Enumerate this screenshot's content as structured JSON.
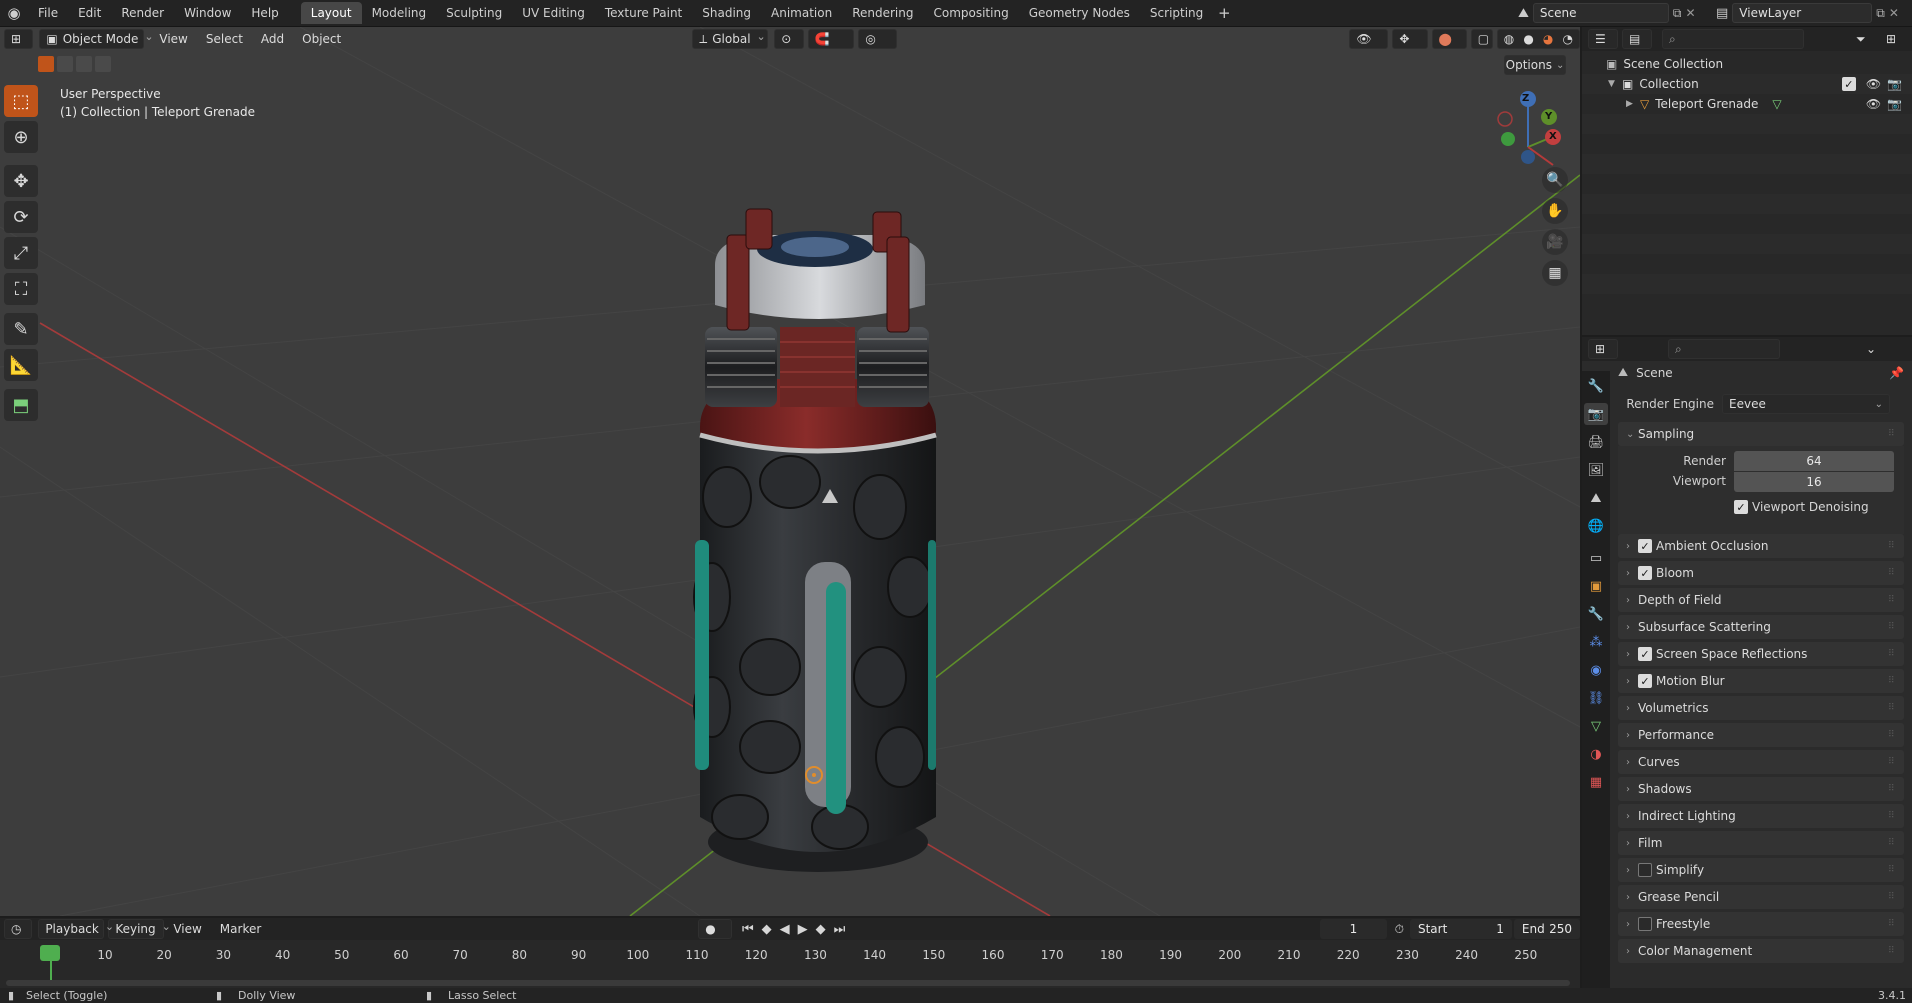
{
  "menu": [
    "File",
    "Edit",
    "Render",
    "Window",
    "Help"
  ],
  "workspaces": [
    "Layout",
    "Modeling",
    "Sculpting",
    "UV Editing",
    "Texture Paint",
    "Shading",
    "Animation",
    "Rendering",
    "Compositing",
    "Geometry Nodes",
    "Scripting"
  ],
  "active_workspace": "Layout",
  "scene_name": "Scene",
  "view_layer": "ViewLayer",
  "viewport": {
    "mode": "Object Mode",
    "menus": [
      "View",
      "Select",
      "Add",
      "Object"
    ],
    "orientation": "Global",
    "options_label": "Options",
    "perspective_label": "User Perspective",
    "collection_label": "(1) Collection | Teleport Grenade",
    "gizmo": {
      "x": "X",
      "y": "Y",
      "z": "Z"
    }
  },
  "outliner": {
    "scene_collection": "Scene Collection",
    "collection": "Collection",
    "object": "Teleport Grenade"
  },
  "properties": {
    "context": "Scene",
    "render_engine_label": "Render Engine",
    "render_engine": "Eevee",
    "sampling": {
      "title": "Sampling",
      "render_label": "Render",
      "render_value": "64",
      "viewport_label": "Viewport",
      "viewport_value": "16",
      "denoise_label": "Viewport Denoising",
      "denoise_checked": true
    },
    "panels": [
      {
        "label": "Ambient Occlusion",
        "checkbox": true
      },
      {
        "label": "Bloom",
        "checkbox": true
      },
      {
        "label": "Depth of Field",
        "checkbox": null
      },
      {
        "label": "Subsurface Scattering",
        "checkbox": null
      },
      {
        "label": "Screen Space Reflections",
        "checkbox": true
      },
      {
        "label": "Motion Blur",
        "checkbox": true
      },
      {
        "label": "Volumetrics",
        "checkbox": null
      },
      {
        "label": "Performance",
        "checkbox": null
      },
      {
        "label": "Curves",
        "checkbox": null
      },
      {
        "label": "Shadows",
        "checkbox": null
      },
      {
        "label": "Indirect Lighting",
        "checkbox": null
      },
      {
        "label": "Film",
        "checkbox": null
      },
      {
        "label": "Simplify",
        "checkbox": false
      },
      {
        "label": "Grease Pencil",
        "checkbox": null
      },
      {
        "label": "Freestyle",
        "checkbox": false
      },
      {
        "label": "Color Management",
        "checkbox": null
      }
    ]
  },
  "timeline": {
    "menus": [
      "Playback",
      "Keying",
      "View",
      "Marker"
    ],
    "current_frame": "1",
    "start_label": "Start",
    "start": "1",
    "end_label": "End",
    "end": "250",
    "ticks": [
      "1",
      "10",
      "20",
      "30",
      "40",
      "50",
      "60",
      "70",
      "80",
      "90",
      "100",
      "110",
      "120",
      "130",
      "140",
      "150",
      "160",
      "170",
      "180",
      "190",
      "200",
      "210",
      "220",
      "230",
      "240",
      "250"
    ]
  },
  "status": {
    "select": "Select (Toggle)",
    "dolly": "Dolly View",
    "lasso": "Lasso Select",
    "version": "3.4.1"
  }
}
